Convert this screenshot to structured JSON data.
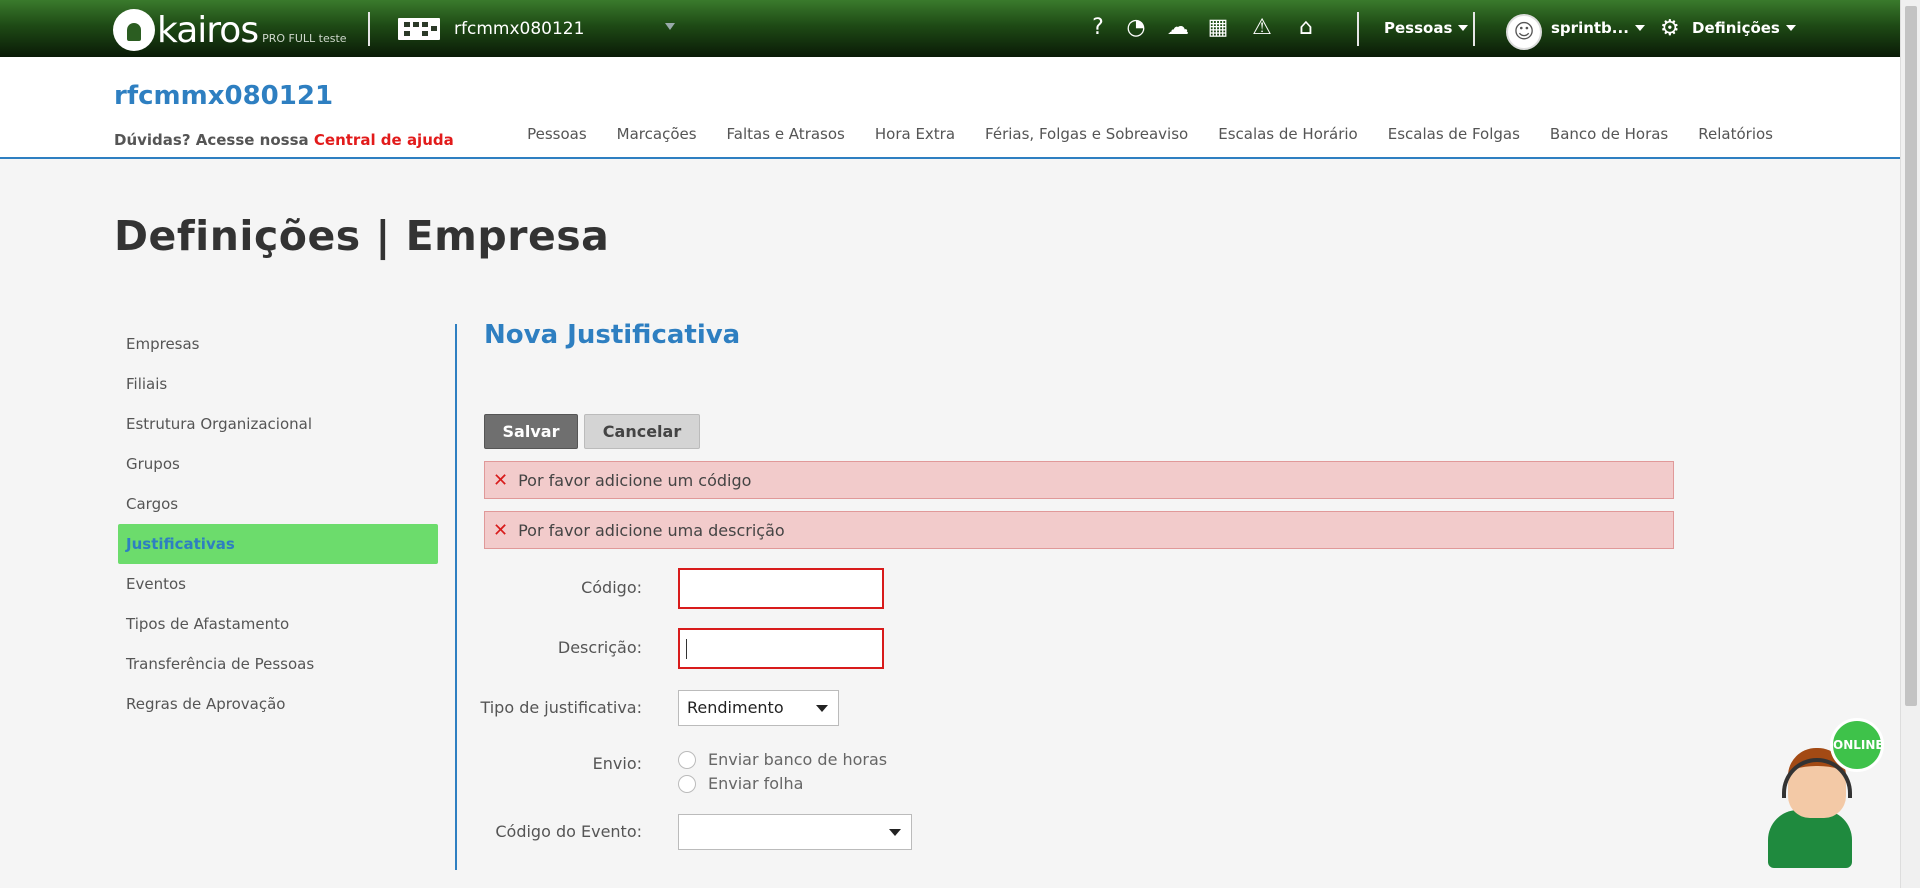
{
  "topbar": {
    "logo_text": "kairos",
    "logo_sub": "PRO FULL teste",
    "company_selector": "rfcmmx080121",
    "people_menu": "Pessoas",
    "user_menu": "sprintb...",
    "settings_menu": "Definições",
    "icons": [
      "help-icon",
      "chat-bubble-icon",
      "cloud-upload-icon",
      "calculator-icon",
      "warning-icon",
      "inbox-icon"
    ]
  },
  "header": {
    "company_title": "rfcmmx080121",
    "help_prefix": "Dúvidas? Acesse nossa",
    "help_link": "Central de ajuda",
    "nav": [
      "Pessoas",
      "Marcações",
      "Faltas e Atrasos",
      "Hora Extra",
      "Férias, Folgas e Sobreaviso",
      "Escalas de Horário",
      "Escalas de Folgas",
      "Banco de Horas",
      "Relatórios"
    ]
  },
  "page": {
    "title": "Definições | Empresa"
  },
  "sidebar": {
    "items": [
      {
        "label": "Empresas"
      },
      {
        "label": "Filiais"
      },
      {
        "label": "Estrutura Organizacional"
      },
      {
        "label": "Grupos"
      },
      {
        "label": "Cargos"
      },
      {
        "label": "Justificativas",
        "active": true
      },
      {
        "label": "Eventos"
      },
      {
        "label": "Tipos de Afastamento"
      },
      {
        "label": "Transferência de Pessoas"
      },
      {
        "label": "Regras de Aprovação"
      }
    ]
  },
  "form": {
    "title": "Nova Justificativa",
    "save_label": "Salvar",
    "cancel_label": "Cancelar",
    "errors": [
      "Por favor adicione um código",
      "Por favor adicione uma descrição"
    ],
    "codigo_label": "Código:",
    "codigo_value": "",
    "descricao_label": "Descrição:",
    "descricao_value": "",
    "tipo_label": "Tipo de justificativa:",
    "tipo_value": "Rendimento",
    "envio_label": "Envio:",
    "envio_options": [
      "Enviar banco de horas",
      "Enviar folha"
    ],
    "evento_label": "Código do Evento:",
    "evento_value": ""
  },
  "chat": {
    "badge": "ONLINE"
  },
  "colors": {
    "accent_blue": "#2e7fc1",
    "active_green": "#6cdc6c",
    "error_red": "#d81b1b",
    "error_bg": "#f2cbcb"
  }
}
